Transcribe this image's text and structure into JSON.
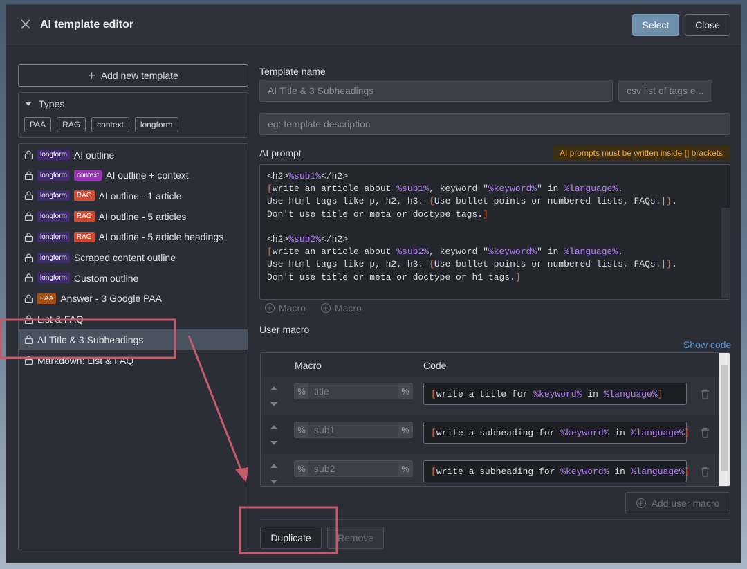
{
  "header": {
    "title": "AI template editor",
    "select_label": "Select",
    "close_label": "Close"
  },
  "left": {
    "add_template_label": "Add new template",
    "types_label": "Types",
    "type_chips": [
      "PAA",
      "RAG",
      "context",
      "longform"
    ],
    "templates": [
      {
        "label": "AI outline",
        "badges": [
          "longform"
        ]
      },
      {
        "label": "AI outline + context",
        "badges": [
          "longform",
          "context"
        ]
      },
      {
        "label": "AI outline - 1 article",
        "badges": [
          "longform",
          "RAG"
        ]
      },
      {
        "label": "AI outline - 5 articles",
        "badges": [
          "longform",
          "RAG"
        ]
      },
      {
        "label": "AI outline - 5 article headings",
        "badges": [
          "longform",
          "RAG"
        ]
      },
      {
        "label": "Scraped content outline",
        "badges": [
          "longform"
        ]
      },
      {
        "label": "Custom outline",
        "badges": [
          "longform"
        ]
      },
      {
        "label": "Answer - 3 Google PAA",
        "badges": [
          "PAA"
        ]
      },
      {
        "label": "List & FAQ",
        "badges": []
      },
      {
        "label": "AI Title & 3 Subheadings",
        "badges": [],
        "selected": true
      },
      {
        "label": "Markdown: List & FAQ",
        "badges": []
      }
    ]
  },
  "form": {
    "template_name_label": "Template name",
    "template_name_value": "AI Title & 3 Subheadings",
    "tags_placeholder": "csv list of tags e...",
    "description_placeholder": "eg: template description",
    "ai_prompt_label": "AI prompt",
    "prompt_warning": "AI prompts must be written inside [] brackets",
    "macro_button_1": "Macro",
    "macro_button_2": "Macro",
    "user_macro_label": "User macro",
    "show_code_label": "Show code",
    "macro_col": "Macro",
    "code_col": "Code",
    "add_user_macro_label": "Add user macro",
    "duplicate_label": "Duplicate",
    "remove_label": "Remove"
  },
  "prompt_lines": [
    [
      [
        "tag",
        "<h2>"
      ],
      [
        "var",
        "%sub1%"
      ],
      [
        "tag",
        "</h2>"
      ]
    ],
    [
      [
        "br",
        "["
      ],
      [
        "tag",
        "write an article about "
      ],
      [
        "var",
        "%sub1%"
      ],
      [
        "tag",
        ", keyword \""
      ],
      [
        "var",
        "%keyword%"
      ],
      [
        "tag",
        "\" in "
      ],
      [
        "var",
        "%language%"
      ],
      [
        "tag",
        "."
      ]
    ],
    [
      [
        "tag",
        "Use html tags like p, h2, h3. "
      ],
      [
        "br",
        "{"
      ],
      [
        "tag",
        "Use bullet points or numbered lists, FAQs."
      ],
      [
        "cur",
        "|"
      ],
      [
        "br",
        "}"
      ],
      [
        "tag",
        "."
      ]
    ],
    [
      [
        "tag",
        "Don't use title or meta or doctype tags."
      ],
      [
        "br",
        "]"
      ]
    ],
    [
      [
        "tag",
        ""
      ]
    ],
    [
      [
        "tag",
        "<h2>"
      ],
      [
        "var",
        "%sub2%"
      ],
      [
        "tag",
        "</h2>"
      ]
    ],
    [
      [
        "br",
        "["
      ],
      [
        "tag",
        "write an article about "
      ],
      [
        "var",
        "%sub2%"
      ],
      [
        "tag",
        ", keyword \""
      ],
      [
        "var",
        "%keyword%"
      ],
      [
        "tag",
        "\" in "
      ],
      [
        "var",
        "%language%"
      ],
      [
        "tag",
        "."
      ]
    ],
    [
      [
        "tag",
        "Use html tags like p, h2, h3. "
      ],
      [
        "br",
        "{"
      ],
      [
        "tag",
        "Use bullet points or numbered lists, FAQs."
      ],
      [
        "cur",
        "|"
      ],
      [
        "br",
        "}"
      ],
      [
        "tag",
        "."
      ]
    ],
    [
      [
        "tag",
        "Don't use title or meta or doctype or h1 tags."
      ],
      [
        "br",
        "]"
      ]
    ]
  ],
  "user_macros": [
    {
      "name": "title",
      "code": [
        [
          "br",
          "["
        ],
        [
          "tag",
          "write a title for "
        ],
        [
          "var",
          "%keyword%"
        ],
        [
          "tag",
          " in "
        ],
        [
          "var",
          "%language%"
        ],
        [
          "br",
          "]"
        ]
      ]
    },
    {
      "name": "sub1",
      "code": [
        [
          "br",
          "["
        ],
        [
          "tag",
          "write a subheading for "
        ],
        [
          "var",
          "%keyword%"
        ],
        [
          "tag",
          " in "
        ],
        [
          "var",
          "%language%"
        ],
        [
          "br",
          "]"
        ]
      ]
    },
    {
      "name": "sub2",
      "code": [
        [
          "br",
          "["
        ],
        [
          "tag",
          "write a subheading for "
        ],
        [
          "var",
          "%keyword%"
        ],
        [
          "tag",
          " in "
        ],
        [
          "var",
          "%language%"
        ],
        [
          "br",
          "]"
        ]
      ]
    }
  ],
  "colors": {
    "accent": "#6e90ad",
    "annotation": "#c45b6a",
    "badge_longform": "#3f2b6e",
    "badge_context": "#9a36b6",
    "badge_rag": "#d8482c",
    "badge_paa": "#a84f14"
  }
}
